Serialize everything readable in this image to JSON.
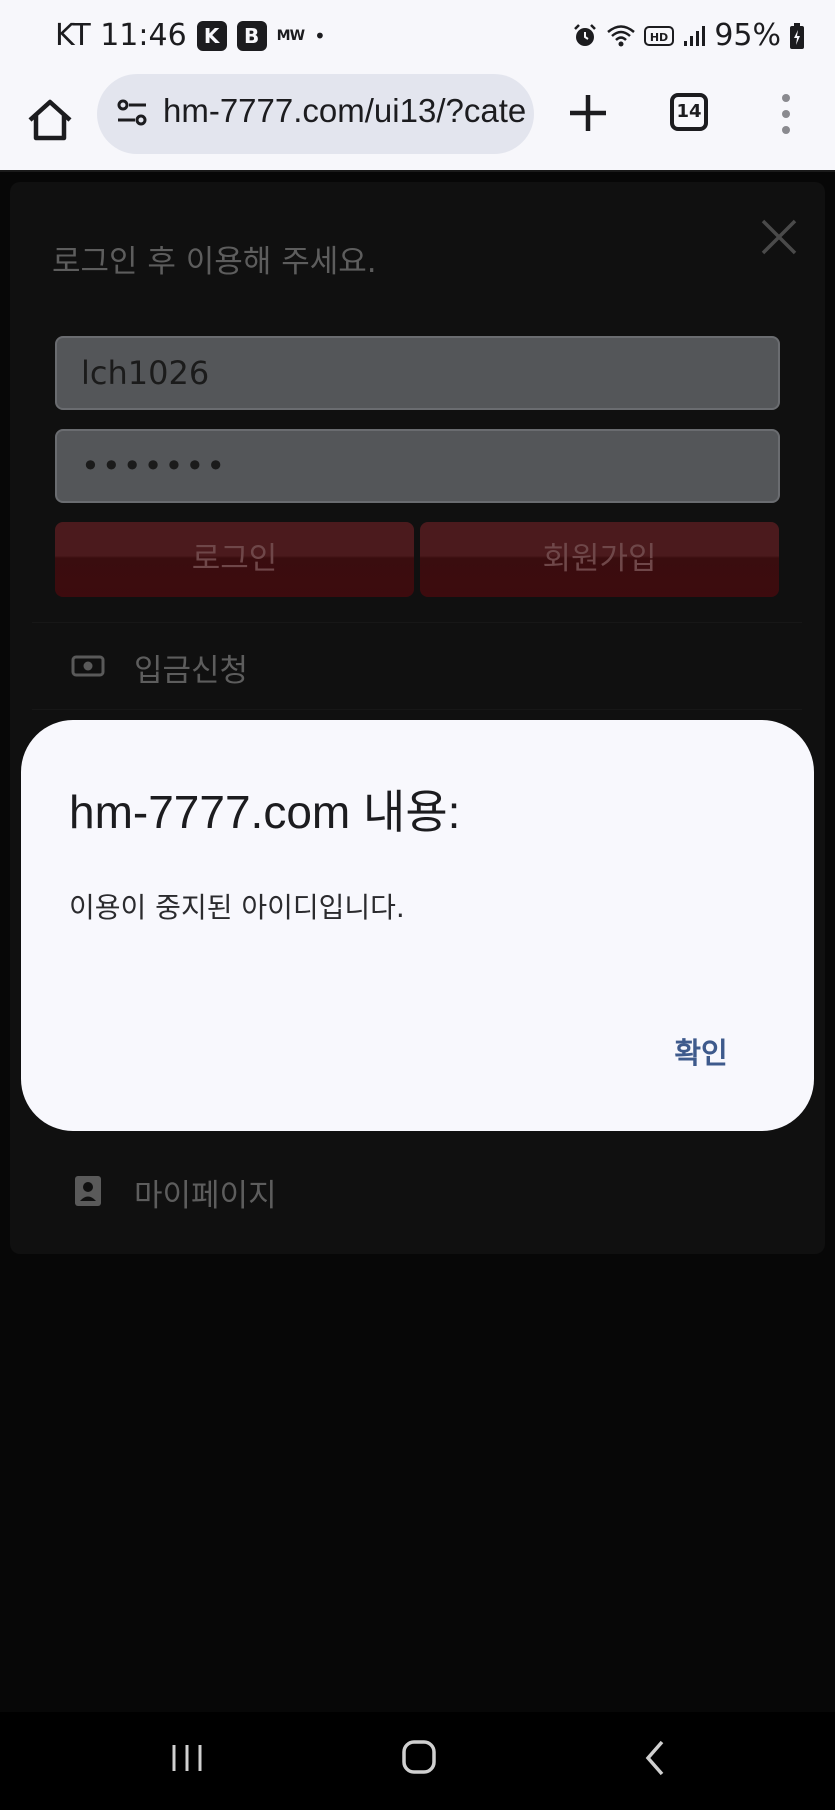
{
  "status_bar": {
    "carrier_time": "KT 11:46",
    "app_badge_1": "",
    "app_badge_2": "",
    "mw_label": "MW",
    "battery": "95%"
  },
  "browser": {
    "url": "hm-7777.com/ui13/?cate",
    "tab_count": "14"
  },
  "page": {
    "login_prompt": "로그인 후 이용해 주세요.",
    "username_value": "lch1026",
    "password_value": "•••••••",
    "login_button": "로그인",
    "signup_button": "회원가입",
    "menu_deposit": "입금신청",
    "menu_mypage": "마이페이지"
  },
  "dialog": {
    "title": "hm-7777.com 내용:",
    "message": "이용이 중지된 아이디입니다.",
    "ok_button": "확인"
  },
  "colors": {
    "accent_dialog_button": "#3e5a8c",
    "login_button_red": "#3d0b0e",
    "page_background": "#070707"
  }
}
